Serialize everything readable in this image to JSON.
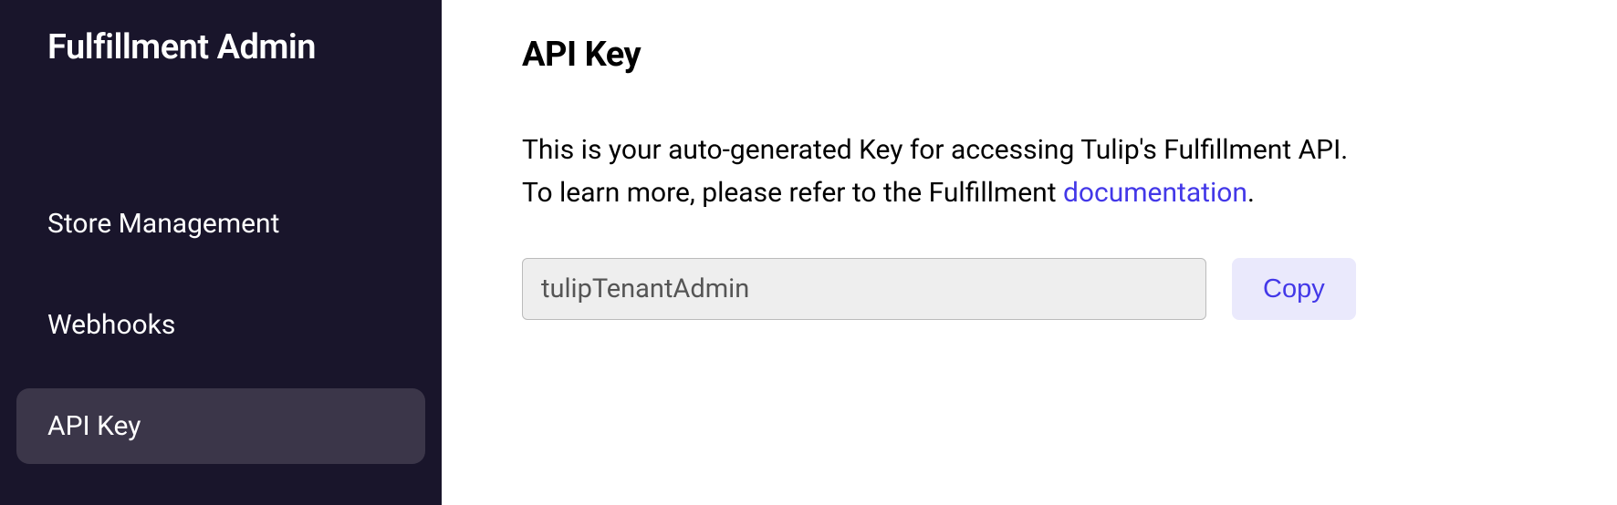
{
  "sidebar": {
    "title": "Fulfillment Admin",
    "items": [
      {
        "label": "Store Management",
        "active": false
      },
      {
        "label": "Webhooks",
        "active": false
      },
      {
        "label": "API Key",
        "active": true
      }
    ]
  },
  "main": {
    "title": "API Key",
    "description_line1": "This is your auto-generated Key for accessing Tulip's Fulfillment API.",
    "description_line2_prefix": "To learn more, please refer to the Fulfillment ",
    "description_link_text": "documentation",
    "description_line2_suffix": ".",
    "api_key_value": "tulipTenantAdmin",
    "copy_button_label": "Copy"
  }
}
